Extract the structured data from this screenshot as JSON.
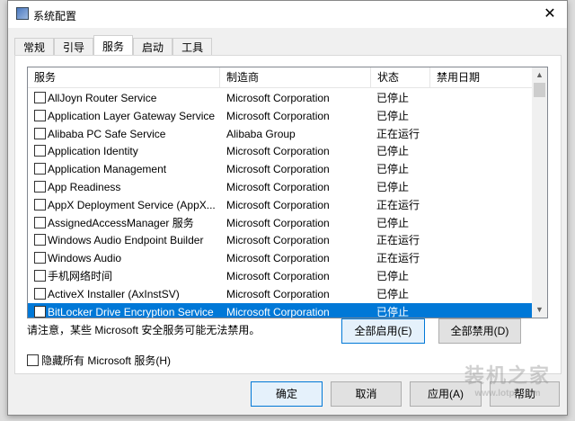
{
  "window": {
    "title": "系统配置",
    "close": "✕"
  },
  "tabs": [
    "常规",
    "引导",
    "服务",
    "启动",
    "工具"
  ],
  "columns": [
    "服务",
    "制造商",
    "状态",
    "禁用日期"
  ],
  "rows": [
    {
      "service": "AllJoyn Router Service",
      "maker": "Microsoft Corporation",
      "status": "已停止"
    },
    {
      "service": "Application Layer Gateway Service",
      "maker": "Microsoft Corporation",
      "status": "已停止"
    },
    {
      "service": "Alibaba PC Safe Service",
      "maker": "Alibaba Group",
      "status": "正在运行"
    },
    {
      "service": "Application Identity",
      "maker": "Microsoft Corporation",
      "status": "已停止"
    },
    {
      "service": "Application Management",
      "maker": "Microsoft Corporation",
      "status": "已停止"
    },
    {
      "service": "App Readiness",
      "maker": "Microsoft Corporation",
      "status": "已停止"
    },
    {
      "service": "AppX Deployment Service (AppX...",
      "maker": "Microsoft Corporation",
      "status": "正在运行"
    },
    {
      "service": "AssignedAccessManager 服务",
      "maker": "Microsoft Corporation",
      "status": "已停止"
    },
    {
      "service": "Windows Audio Endpoint Builder",
      "maker": "Microsoft Corporation",
      "status": "正在运行"
    },
    {
      "service": "Windows Audio",
      "maker": "Microsoft Corporation",
      "status": "正在运行"
    },
    {
      "service": "手机网络时间",
      "maker": "Microsoft Corporation",
      "status": "已停止"
    },
    {
      "service": "ActiveX Installer (AxInstSV)",
      "maker": "Microsoft Corporation",
      "status": "已停止"
    },
    {
      "service": "BitLocker Drive Encryption Service",
      "maker": "Microsoft Corporation",
      "status": "已停止"
    }
  ],
  "note": "请注意，某些 Microsoft 安全服务可能无法禁用。",
  "enable_all": "全部启用(E)",
  "disable_all": "全部禁用(D)",
  "hide_ms": "隐藏所有 Microsoft 服务(H)",
  "buttons": {
    "ok": "确定",
    "cancel": "取消",
    "apply": "应用(A)",
    "help": "帮助"
  },
  "watermark": {
    "name": "装机之家",
    "url": "www.lotpc.com"
  }
}
